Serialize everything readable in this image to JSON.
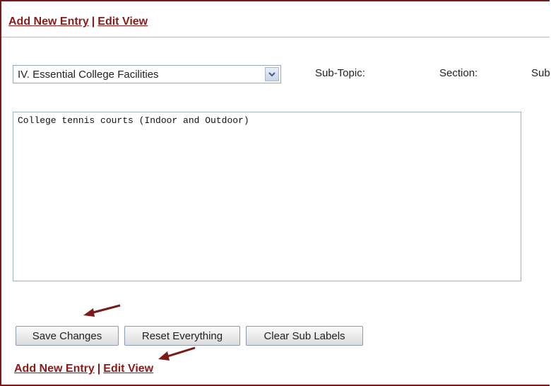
{
  "top_nav": {
    "add_new_entry": "Add New Entry",
    "separator": "|",
    "edit_view": "Edit View"
  },
  "topic": {
    "selected": "IV. Essential College Facilities"
  },
  "labels": {
    "sub_topic": "Sub-Topic:",
    "section": "Section:",
    "sub_partial": "Sub"
  },
  "entry": {
    "text": "College tennis courts (Indoor and Outdoor)"
  },
  "buttons": {
    "save": "Save Changes",
    "reset": "Reset Everything",
    "clear": "Clear Sub Labels"
  },
  "bottom_nav": {
    "add_new_entry": "Add New Entry",
    "separator": "|",
    "edit_view": "Edit View"
  },
  "colors": {
    "link": "#8b1a1a",
    "frame_border": "#7b1a1a",
    "annotation_arrow": "#7b1a1a"
  },
  "icons": {
    "dropdown": "chevron-down-icon",
    "annotation": "arrow-annotation-icon"
  }
}
